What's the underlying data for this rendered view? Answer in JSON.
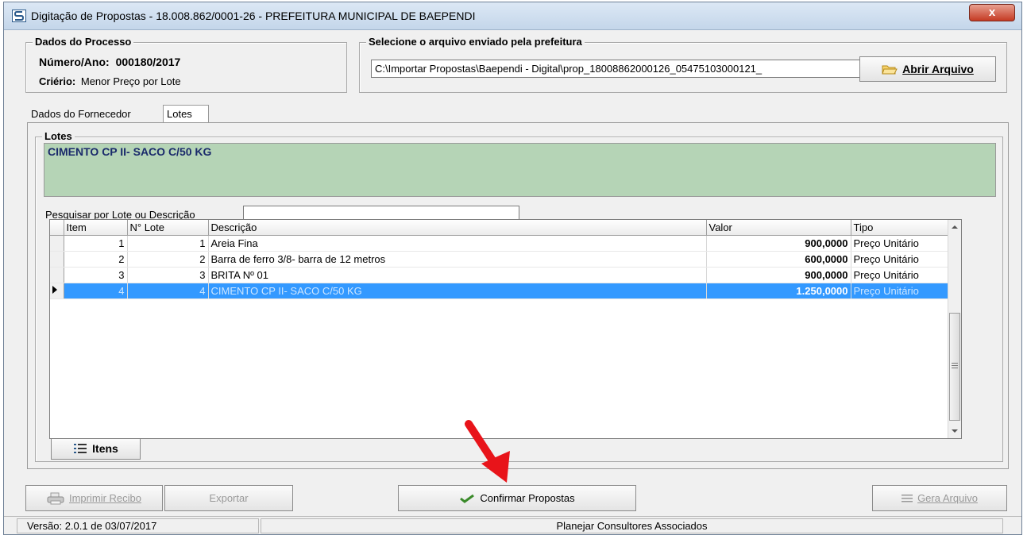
{
  "window": {
    "title": "Digitação de Propostas - 18.008.862/0001-26 - PREFEITURA MUNICIPAL DE BAEPENDI",
    "close_label": "x"
  },
  "processo": {
    "group_title": "Dados do Processo",
    "numero_label": "Número/Ano:",
    "numero_value": "000180/2017",
    "criterio_label": "Criério:",
    "criterio_value": "Menor Preço por Lote"
  },
  "arquivo": {
    "group_title": "Selecione o arquivo enviado pela prefeitura",
    "path": "C:\\Importar Propostas\\Baependi - Digital\\prop_18008862000126_05475103000121_",
    "open_button": "Abrir Arquivo"
  },
  "tabs": [
    {
      "label": "Dados do Fornecedor"
    },
    {
      "label": "Lotes"
    }
  ],
  "lotes": {
    "group_title": "Lotes",
    "description": "CIMENTO CP II- SACO C/50 KG",
    "search_label": "Pesquisar por Lote ou Descrição",
    "search_value": "",
    "columns": [
      "Item",
      "N° Lote",
      "Descrição",
      "Valor",
      "Tipo"
    ],
    "rows": [
      {
        "item": "1",
        "lote": "1",
        "descricao": "Areia Fina",
        "valor": "900,0000",
        "tipo": "Preço Unitário"
      },
      {
        "item": "2",
        "lote": "2",
        "descricao": "Barra de ferro 3/8- barra de 12 metros",
        "valor": "600,0000",
        "tipo": "Preço Unitário"
      },
      {
        "item": "3",
        "lote": "3",
        "descricao": "BRITA Nº 01",
        "valor": "900,0000",
        "tipo": "Preço Unitário"
      },
      {
        "item": "4",
        "lote": "4",
        "descricao": "CIMENTO CP II- SACO C/50 KG",
        "valor": "1.250,0000",
        "tipo": "Preço Unitário"
      }
    ],
    "itens_button": "Itens"
  },
  "actions": {
    "imprimir": "Imprimir Recibo",
    "exportar": "Exportar",
    "confirmar": "Confirmar Propostas",
    "gera": "Gera Arquivo"
  },
  "status": {
    "version": "Versão: 2.0.1 de 03/07/2017",
    "company": "Planejar Consultores Associados"
  },
  "colors": {
    "lote_panel": "#b5d4b6",
    "selection": "#3399ff",
    "arrow": "#e8141a"
  }
}
